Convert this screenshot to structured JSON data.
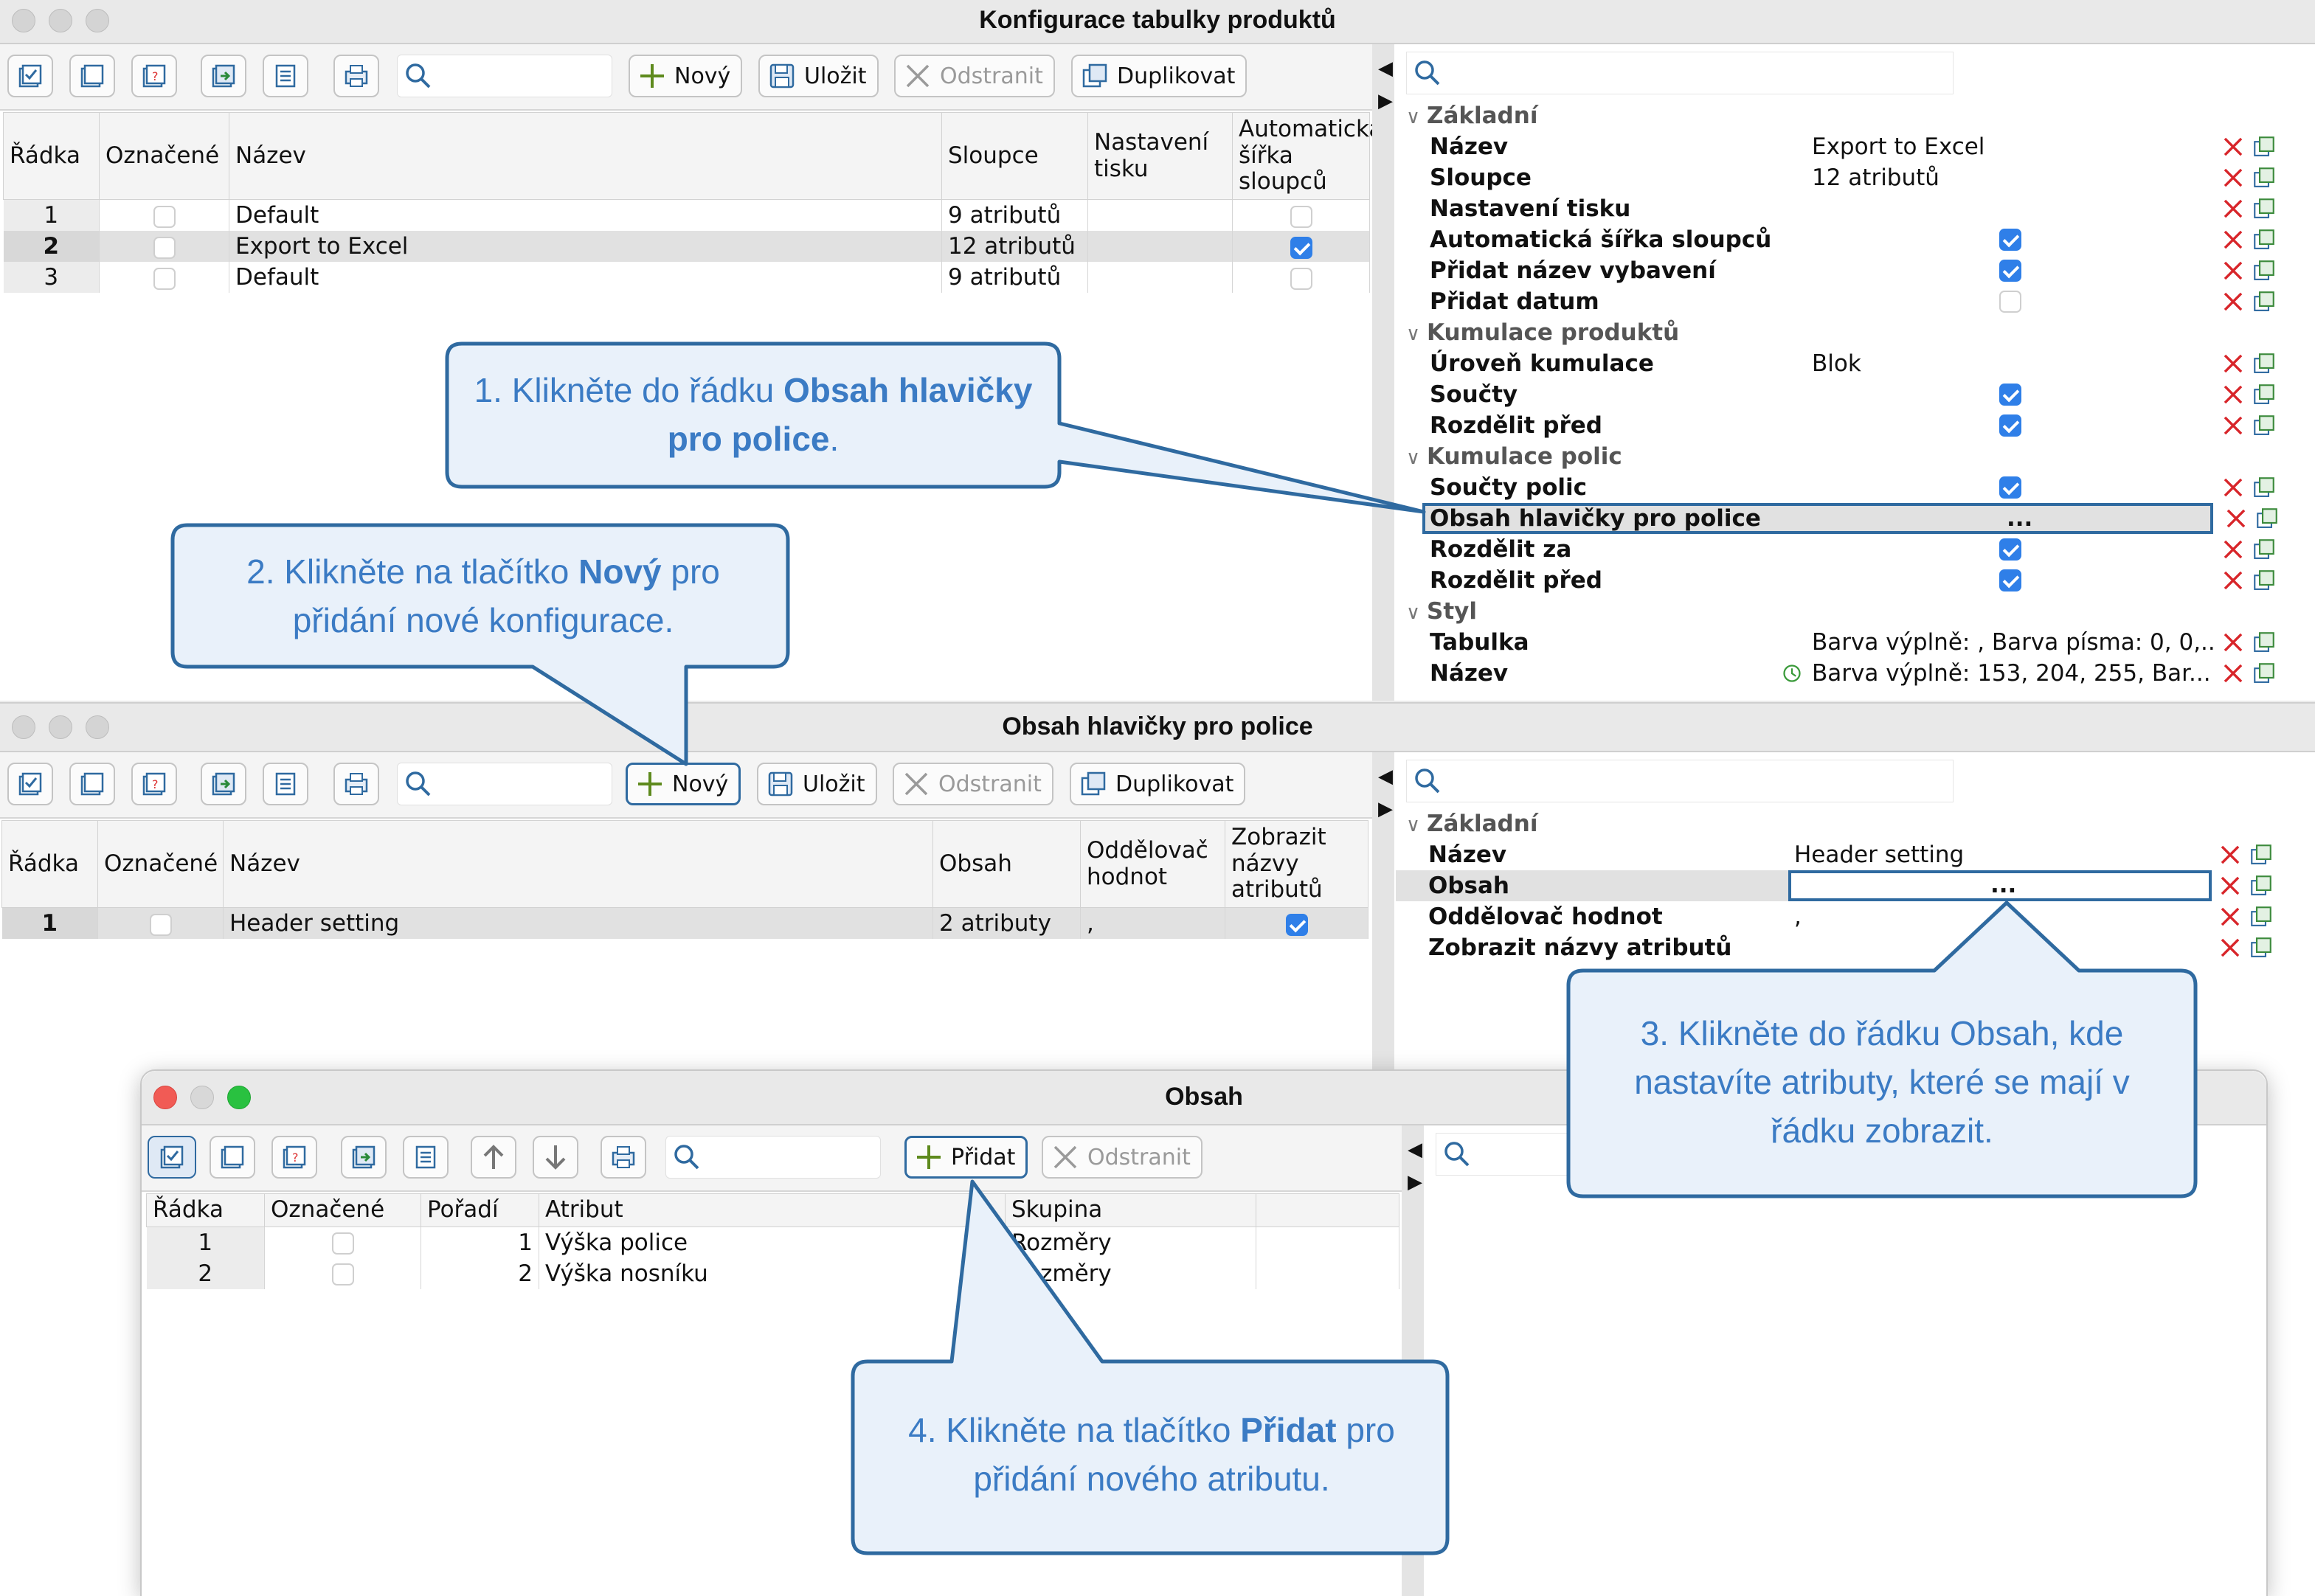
{
  "window1": {
    "title": "Konfigurace tabulky produktů",
    "toolbar": {
      "new": "Nový",
      "save": "Uložit",
      "delete": "Odstranit",
      "duplicate": "Duplikovat"
    },
    "columns": [
      "Řádka",
      "Označené",
      "Název",
      "Sloupce",
      "Nastavení tisku",
      "Automatická šířka sloupců"
    ],
    "rows": [
      {
        "n": "1",
        "name": "Default",
        "cols": "9 atributů",
        "auto": false
      },
      {
        "n": "2",
        "name": "Export to Excel",
        "cols": "12 atributů",
        "auto": true
      },
      {
        "n": "3",
        "name": "Default",
        "cols": "9 atributů",
        "auto": false
      }
    ],
    "props": {
      "sec_basic": "Základní",
      "name_k": "Název",
      "name_v": "Export to Excel",
      "cols_k": "Sloupce",
      "cols_v": "12 atributů",
      "print_k": "Nastavení tisku",
      "autow_k": "Automatická šířka sloupců",
      "addequip_k": "Přidat název vybavení",
      "adddate_k": "Přidat datum",
      "sec_cumprod": "Kumulace produktů",
      "level_k": "Úroveň kumulace",
      "level_v": "Blok",
      "sums_k": "Součty",
      "splitbefore_k": "Rozdělit před",
      "sec_cumshelf": "Kumulace polic",
      "shelfsums_k": "Součty polic",
      "header_k": "Obsah hlavičky pro police",
      "header_v": "...",
      "splitafter_k": "Rozdělit za",
      "splitbefore2_k": "Rozdělit před",
      "sec_style": "Styl",
      "table_k": "Tabulka",
      "table_v": "Barva výplně: , Barva písma: 0, 0,...",
      "name2_k": "Název",
      "name2_v": "Barva výplně: 153, 204, 255, Bar..."
    }
  },
  "window2": {
    "title": "Obsah hlavičky pro police",
    "toolbar": {
      "new": "Nový",
      "save": "Uložit",
      "delete": "Odstranit",
      "duplicate": "Duplikovat"
    },
    "columns": [
      "Řádka",
      "Označené",
      "Název",
      "Obsah",
      "Oddělovač hodnot",
      "Zobrazit názvy atributů"
    ],
    "rows": [
      {
        "n": "1",
        "name": "Header setting",
        "content": "2 atributy",
        "sep": ",",
        "show": true
      }
    ],
    "props": {
      "sec_basic": "Základní",
      "name_k": "Název",
      "name_v": "Header setting",
      "content_k": "Obsah",
      "content_v": "...",
      "sep_k": "Oddělovač hodnot",
      "sep_v": ",",
      "show_k": "Zobrazit názvy atributů"
    }
  },
  "window3": {
    "title": "Obsah",
    "toolbar": {
      "add": "Přidat",
      "delete": "Odstranit"
    },
    "columns": [
      "Řádka",
      "Označené",
      "Pořadí",
      "Atribut",
      "Skupina"
    ],
    "rows": [
      {
        "n": "1",
        "order": "1",
        "attr": "Výška police",
        "group": "Rozměry"
      },
      {
        "n": "2",
        "order": "2",
        "attr": "Výška nosníku",
        "group": "Rozměry"
      }
    ]
  },
  "callouts": {
    "c1": {
      "pre": "1. Klikněte do řádku ",
      "bold": "Obsah hlavičky pro police",
      "post": "."
    },
    "c2": {
      "pre": "2. Klikněte na tlačítko ",
      "bold": "Nový",
      "post": " pro přidání nové konfigurace."
    },
    "c3": {
      "text": "3. Klikněte do řádku Obsah, kde nastavíte atributy, které se mají v řádku zobrazit."
    },
    "c4": {
      "pre": "4. Klikněte na tlačítko ",
      "bold": "Přidat",
      "post": " pro přidání nového atributu."
    }
  },
  "colors": {
    "accent": "#3b7bc4",
    "callout_fill": "#e9f1fa",
    "checkbox": "#2f7fe8",
    "delete_x": "#d8252a"
  },
  "icons": [
    "select-all-icon",
    "deselect-icon",
    "invert-selection-icon",
    "export-icon",
    "list-icon",
    "print-icon",
    "search-icon",
    "plus-icon",
    "save-icon",
    "delete-x-icon",
    "duplicate-icon",
    "arrow-up-icon",
    "arrow-down-icon",
    "copy-icon"
  ]
}
